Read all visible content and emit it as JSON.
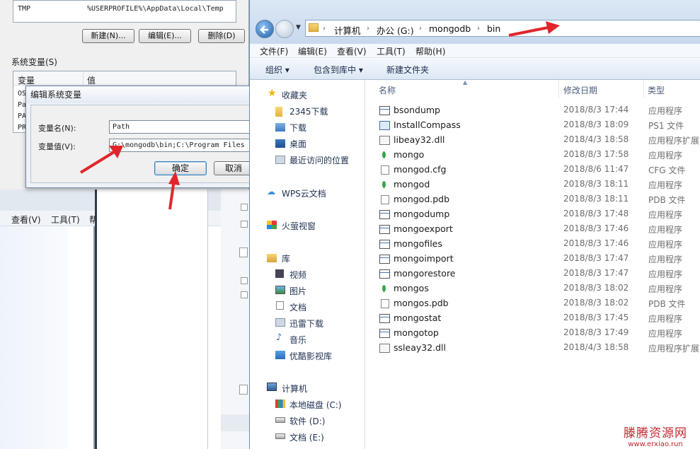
{
  "env_dialog": {
    "user_var_row": {
      "name": "TMP",
      "value": "%USERPROFILE%\\AppData\\Local\\Temp"
    },
    "buttons": {
      "new": "新建(N)...",
      "edit": "编辑(E)...",
      "delete": "删除(D)"
    },
    "system_vars_label": "系统变量(S)",
    "col_var": "变量",
    "col_val": "值",
    "rows": [
      "OS",
      "Pa",
      "PA",
      "PR"
    ]
  },
  "edit_dialog": {
    "title": "编辑系统变量",
    "name_label": "变量名(N):",
    "name_value": "Path",
    "value_label": "变量值(V):",
    "value_value": "G:\\mongodb\\bin;C:\\Program Files",
    "ok": "确定",
    "cancel": "取消"
  },
  "bg_window": {
    "menu_view": "查看(V)",
    "menu_tools": "工具(T)",
    "menu_more": "帮"
  },
  "explorer": {
    "breadcrumbs": [
      "计算机",
      "办公 (G:)",
      "mongodb",
      "bin"
    ],
    "menu": [
      "文件(F)",
      "编辑(E)",
      "查看(V)",
      "工具(T)",
      "帮助(H)"
    ],
    "commands": [
      "组织 ▾",
      "包含到库中 ▾",
      "新建文件夹"
    ],
    "nav": {
      "favorites": "收藏夹",
      "fav_items": [
        "2345下载",
        "下载",
        "桌面",
        "最近访问的位置"
      ],
      "wps": "WPS云文档",
      "huoying": "火萤视窗",
      "library": "库",
      "lib_items": [
        "视频",
        "图片",
        "文档",
        "迅雷下载",
        "音乐",
        "优酷影视库"
      ],
      "computer": "计算机",
      "drives": [
        "本地磁盘 (C:)",
        "软件 (D:)",
        "文档 (E:)"
      ]
    },
    "columns": {
      "name": "名称",
      "date": "修改日期",
      "type": "类型"
    },
    "files": [
      {
        "name": "bsondump",
        "date": "2018/8/3 17:44",
        "type": "应用程序",
        "icon": "exe"
      },
      {
        "name": "InstallCompass",
        "date": "2018/8/3 18:09",
        "type": "PS1 文件",
        "icon": "ps1"
      },
      {
        "name": "libeay32.dll",
        "date": "2018/4/3 18:58",
        "type": "应用程序扩展",
        "icon": "dll"
      },
      {
        "name": "mongo",
        "date": "2018/8/3 17:58",
        "type": "应用程序",
        "icon": "leaf"
      },
      {
        "name": "mongod.cfg",
        "date": "2018/8/6 11:47",
        "type": "CFG 文件",
        "icon": "doc"
      },
      {
        "name": "mongod",
        "date": "2018/8/3 18:11",
        "type": "应用程序",
        "icon": "leaf"
      },
      {
        "name": "mongod.pdb",
        "date": "2018/8/3 18:11",
        "type": "PDB 文件",
        "icon": "doc"
      },
      {
        "name": "mongodump",
        "date": "2018/8/3 17:48",
        "type": "应用程序",
        "icon": "exe"
      },
      {
        "name": "mongoexport",
        "date": "2018/8/3 17:46",
        "type": "应用程序",
        "icon": "exe"
      },
      {
        "name": "mongofiles",
        "date": "2018/8/3 17:46",
        "type": "应用程序",
        "icon": "exe"
      },
      {
        "name": "mongoimport",
        "date": "2018/8/3 17:47",
        "type": "应用程序",
        "icon": "exe"
      },
      {
        "name": "mongorestore",
        "date": "2018/8/3 17:47",
        "type": "应用程序",
        "icon": "exe"
      },
      {
        "name": "mongos",
        "date": "2018/8/3 18:02",
        "type": "应用程序",
        "icon": "leaf"
      },
      {
        "name": "mongos.pdb",
        "date": "2018/8/3 18:02",
        "type": "PDB 文件",
        "icon": "doc"
      },
      {
        "name": "mongostat",
        "date": "2018/8/3 17:45",
        "type": "应用程序",
        "icon": "exe"
      },
      {
        "name": "mongotop",
        "date": "2018/8/3 17:49",
        "type": "应用程序",
        "icon": "exe"
      },
      {
        "name": "ssleay32.dll",
        "date": "2018/4/3 18:58",
        "type": "应用程序扩展",
        "icon": "dll"
      }
    ]
  },
  "watermark": {
    "line1": "滕腾资源网",
    "line2": "www.erxiao.run"
  },
  "colors": {
    "arrow": "#e0262b",
    "accent": "#3c7fb1"
  }
}
